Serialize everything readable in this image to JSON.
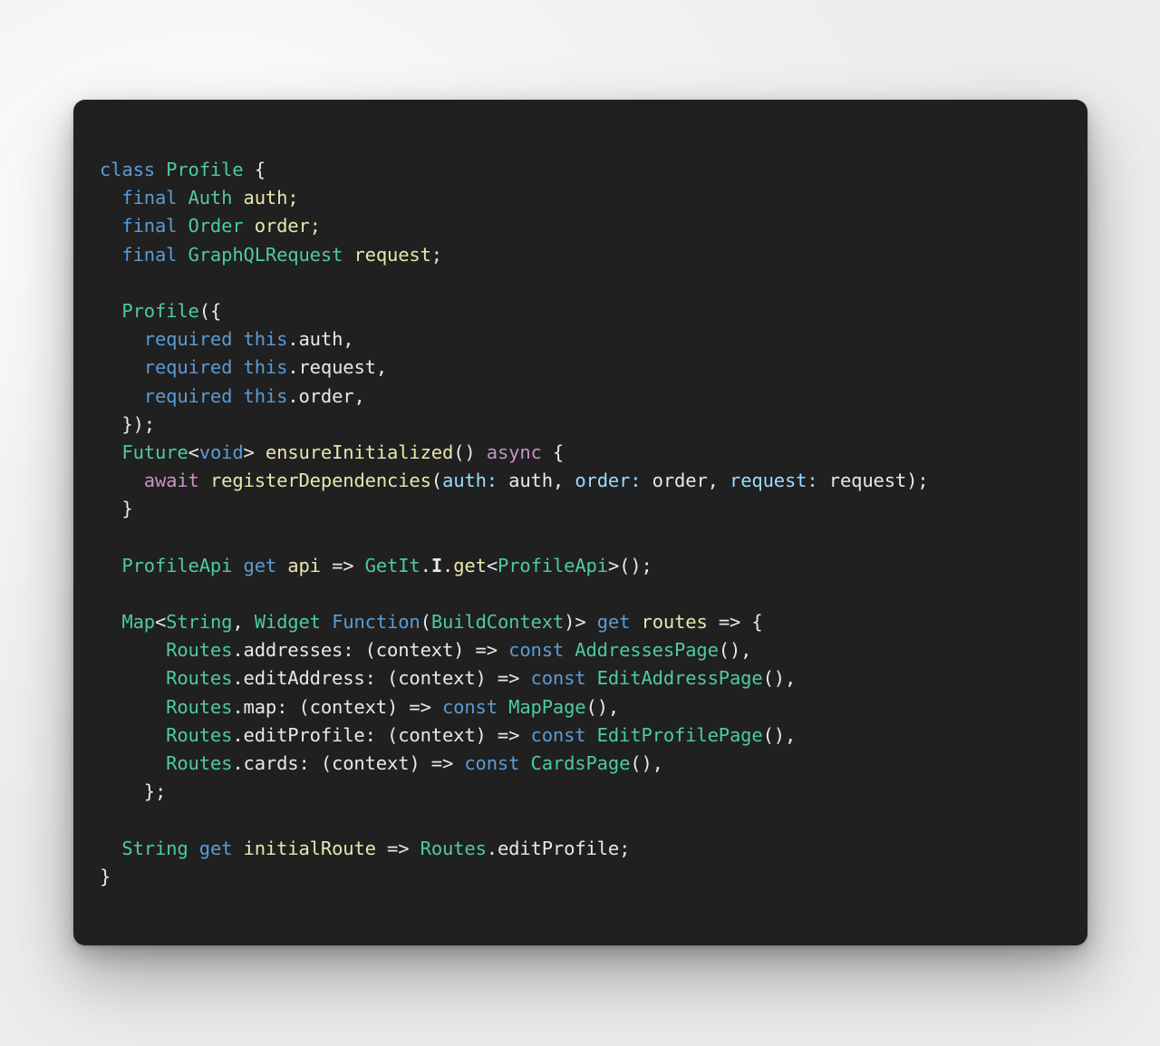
{
  "window": {
    "background_color": "#f0f0f0",
    "card_background_color": "#202020",
    "card_corner_radius": "13px"
  },
  "theme": {
    "keyword_color": "#5b9bd5",
    "type_color": "#4ec9a6",
    "function_color": "#e9e6ae",
    "plain_color": "#e8e8e8",
    "async_color": "#c792c7",
    "argument_color": "#9cdcfe"
  },
  "code": {
    "language": "dart",
    "class_name": "Profile",
    "lines": [
      "class Profile {",
      "  final Auth auth;",
      "  final Order order;",
      "  final GraphQLRequest request;",
      "",
      "  Profile({",
      "    required this.auth,",
      "    required this.request,",
      "    required this.order,",
      "  });",
      "  Future<void> ensureInitialized() async {",
      "    await registerDependencies(auth: auth, order: order, request: request);",
      "  }",
      "",
      "  ProfileApi get api => GetIt.I.get<ProfileApi>();",
      "",
      "  Map<String, Widget Function(BuildContext)> get routes => {",
      "      Routes.addresses: (context) => const AddressesPage(),",
      "      Routes.editAddress: (context) => const EditAddressPage(),",
      "      Routes.map: (context) => const MapPage(),",
      "      Routes.editProfile: (context) => const EditProfilePage(),",
      "      Routes.cards: (context) => const CardsPage(),",
      "    };",
      "",
      "  String get initialRoute => Routes.editProfile;",
      "}"
    ],
    "tokens": [
      [
        [
          "class ",
          "kw"
        ],
        [
          "Profile",
          "typ"
        ],
        [
          " {",
          "plain"
        ]
      ],
      [
        [
          "  ",
          "plain"
        ],
        [
          "final ",
          "kw"
        ],
        [
          "Auth",
          "typ"
        ],
        [
          " ",
          "plain"
        ],
        [
          "auth;",
          "fn"
        ]
      ],
      [
        [
          "  ",
          "plain"
        ],
        [
          "final ",
          "kw"
        ],
        [
          "Order",
          "typ"
        ],
        [
          " ",
          "plain"
        ],
        [
          "order;",
          "fn"
        ]
      ],
      [
        [
          "  ",
          "plain"
        ],
        [
          "final ",
          "kw"
        ],
        [
          "GraphQLRequest",
          "typ"
        ],
        [
          " ",
          "plain"
        ],
        [
          "request;",
          "fn"
        ]
      ],
      [
        [
          "",
          "plain"
        ]
      ],
      [
        [
          "  ",
          "plain"
        ],
        [
          "Profile",
          "typ"
        ],
        [
          "({",
          "plain"
        ]
      ],
      [
        [
          "    ",
          "plain"
        ],
        [
          "required ",
          "kw"
        ],
        [
          "this",
          "kw"
        ],
        [
          ".auth,",
          "plain"
        ]
      ],
      [
        [
          "    ",
          "plain"
        ],
        [
          "required ",
          "kw"
        ],
        [
          "this",
          "kw"
        ],
        [
          ".request,",
          "plain"
        ]
      ],
      [
        [
          "    ",
          "plain"
        ],
        [
          "required ",
          "kw"
        ],
        [
          "this",
          "kw"
        ],
        [
          ".order,",
          "plain"
        ]
      ],
      [
        [
          "  });",
          "plain"
        ]
      ],
      [
        [
          "  ",
          "plain"
        ],
        [
          "Future",
          "typ"
        ],
        [
          "<",
          "plain"
        ],
        [
          "void",
          "kw"
        ],
        [
          "> ",
          "plain"
        ],
        [
          "ensureInitialized",
          "fn"
        ],
        [
          "() ",
          "plain"
        ],
        [
          "async",
          "asy"
        ],
        [
          " {",
          "plain"
        ]
      ],
      [
        [
          "    ",
          "plain"
        ],
        [
          "await",
          "asy"
        ],
        [
          " ",
          "plain"
        ],
        [
          "registerDependencies",
          "fn"
        ],
        [
          "(",
          "plain"
        ],
        [
          "auth:",
          "arg"
        ],
        [
          " auth, ",
          "plain"
        ],
        [
          "order:",
          "arg"
        ],
        [
          " order, ",
          "plain"
        ],
        [
          "request:",
          "arg"
        ],
        [
          " request);",
          "plain"
        ]
      ],
      [
        [
          "  }",
          "plain"
        ]
      ],
      [
        [
          "",
          "plain"
        ]
      ],
      [
        [
          "  ",
          "plain"
        ],
        [
          "ProfileApi",
          "typ"
        ],
        [
          " ",
          "plain"
        ],
        [
          "get",
          "kw"
        ],
        [
          " ",
          "plain"
        ],
        [
          "api",
          "fn"
        ],
        [
          " => ",
          "plain"
        ],
        [
          "GetIt",
          "typ"
        ],
        [
          ".",
          "plain"
        ],
        [
          "I",
          "plain bold"
        ],
        [
          ".",
          "plain"
        ],
        [
          "get",
          "fn"
        ],
        [
          "<",
          "plain"
        ],
        [
          "ProfileApi",
          "typ"
        ],
        [
          ">();",
          "plain"
        ]
      ],
      [
        [
          "",
          "plain"
        ]
      ],
      [
        [
          "  ",
          "plain"
        ],
        [
          "Map",
          "typ"
        ],
        [
          "<",
          "plain"
        ],
        [
          "String",
          "typ"
        ],
        [
          ", ",
          "plain"
        ],
        [
          "Widget",
          "typ"
        ],
        [
          " ",
          "plain"
        ],
        [
          "Function",
          "kw"
        ],
        [
          "(",
          "plain"
        ],
        [
          "BuildContext",
          "typ"
        ],
        [
          ")> ",
          "plain"
        ],
        [
          "get",
          "kw"
        ],
        [
          " ",
          "plain"
        ],
        [
          "routes",
          "fn"
        ],
        [
          " => {",
          "plain"
        ]
      ],
      [
        [
          "      ",
          "plain"
        ],
        [
          "Routes",
          "typ"
        ],
        [
          ".addresses: (context) => ",
          "plain"
        ],
        [
          "const",
          "kw"
        ],
        [
          " ",
          "plain"
        ],
        [
          "AddressesPage",
          "typ"
        ],
        [
          "(),",
          "plain"
        ]
      ],
      [
        [
          "      ",
          "plain"
        ],
        [
          "Routes",
          "typ"
        ],
        [
          ".editAddress: (context) => ",
          "plain"
        ],
        [
          "const",
          "kw"
        ],
        [
          " ",
          "plain"
        ],
        [
          "EditAddressPage",
          "typ"
        ],
        [
          "(),",
          "plain"
        ]
      ],
      [
        [
          "      ",
          "plain"
        ],
        [
          "Routes",
          "typ"
        ],
        [
          ".map: (context) => ",
          "plain"
        ],
        [
          "const",
          "kw"
        ],
        [
          " ",
          "plain"
        ],
        [
          "MapPage",
          "typ"
        ],
        [
          "(),",
          "plain"
        ]
      ],
      [
        [
          "      ",
          "plain"
        ],
        [
          "Routes",
          "typ"
        ],
        [
          ".editProfile: (context) => ",
          "plain"
        ],
        [
          "const",
          "kw"
        ],
        [
          " ",
          "plain"
        ],
        [
          "EditProfilePage",
          "typ"
        ],
        [
          "(),",
          "plain"
        ]
      ],
      [
        [
          "      ",
          "plain"
        ],
        [
          "Routes",
          "typ"
        ],
        [
          ".cards: (context) => ",
          "plain"
        ],
        [
          "const",
          "kw"
        ],
        [
          " ",
          "plain"
        ],
        [
          "CardsPage",
          "typ"
        ],
        [
          "(),",
          "plain"
        ]
      ],
      [
        [
          "    };",
          "plain"
        ]
      ],
      [
        [
          "",
          "plain"
        ]
      ],
      [
        [
          "  ",
          "plain"
        ],
        [
          "String",
          "typ"
        ],
        [
          " ",
          "plain"
        ],
        [
          "get",
          "kw"
        ],
        [
          " ",
          "plain"
        ],
        [
          "initialRoute",
          "fn"
        ],
        [
          " => ",
          "plain"
        ],
        [
          "Routes",
          "typ"
        ],
        [
          ".editProfile;",
          "plain"
        ]
      ],
      [
        [
          "}",
          "plain"
        ]
      ]
    ]
  }
}
